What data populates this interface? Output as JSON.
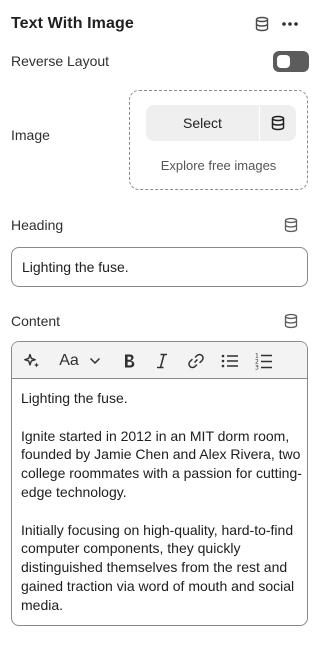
{
  "header": {
    "title": "Text With Image"
  },
  "reverse_layout": {
    "label": "Reverse Layout",
    "enabled": false
  },
  "image": {
    "label": "Image",
    "select_label": "Select",
    "explore_label": "Explore free images"
  },
  "heading": {
    "label": "Heading",
    "value": "Lighting the fuse."
  },
  "content": {
    "label": "Content",
    "toolbar": {
      "font_style_label": "Aa"
    },
    "paragraphs": [
      "Lighting the fuse.",
      "Ignite started in 2012 in an MIT dorm room, founded by Jamie Chen and Alex Rivera, two college roommates with a passion for cutting-edge technology.",
      "Initially focusing on high-quality, hard-to-find computer components, they quickly distinguished themselves from the rest and gained traction via word of mouth and social media."
    ]
  },
  "icons": {
    "database": "database-icon",
    "more": "more-horizontal-icon",
    "ai": "sparkle-icon",
    "bold": "bold-icon",
    "italic": "italic-icon",
    "link": "link-icon",
    "bullet_list": "bullet-list-icon",
    "numbered_list": "numbered-list-icon",
    "chevron": "chevron-down-icon"
  },
  "colors": {
    "toggle_off": "#5c5c5c",
    "border": "#8a8a8a",
    "text": "#303030",
    "toolbar_bg": "#f3f3f3",
    "select_bg": "#efefef"
  }
}
